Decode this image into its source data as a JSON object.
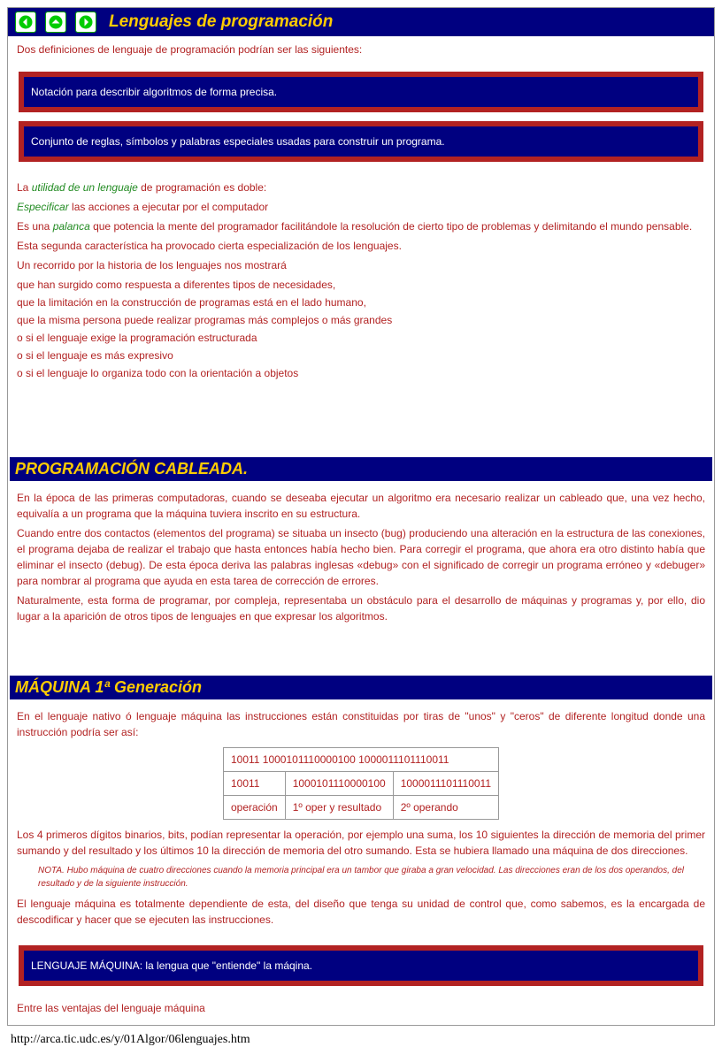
{
  "header": {
    "title": "Lenguajes de programación"
  },
  "intro": "Dos definiciones de lenguaje de programación podrían ser las siguientes:",
  "def1": "Notación para describir algoritmos de forma precisa.",
  "def2": "Conjunto de reglas, símbolos y palabras especiales usadas para construir un programa.",
  "util": {
    "prefix": "La ",
    "em": "utilidad de un lenguaje",
    "suffix": " de programación es doble:"
  },
  "line_especificar": {
    "em": " Especificar",
    "suffix": " las acciones a ejecutar por el computador"
  },
  "line_palanca": {
    "prefix": " Es una ",
    "em": "palanca",
    "suffix": " que potencia la mente del programador facilitándole la resolución de cierto tipo de problemas y delimitando el mundo pensable."
  },
  "line_especializacion": "Esta segunda característica ha provocado cierta especialización de los lenguajes.",
  "line_recorrido": "Un recorrido por la historia de los  lenguajes nos mostrará",
  "bullets": [
    " que han surgido como respuesta a diferentes tipos de necesidades,",
    " que la limitación en la construcción de programas está en el lado humano,",
    " que la misma persona puede realizar programas más complejos o más grandes"
  ],
  "obullets": [
    "o  si el lenguaje exige la programación estructurada",
    "o  si el lenguaje es más expresivo",
    "o  si el lenguaje lo organiza todo con la orientación a objetos"
  ],
  "cableada": {
    "title": "PROGRAMACIÓN CABLEADA.",
    "p1": "En la época de las primeras computadoras, cuando se deseaba ejecutar un algoritmo era necesario realizar un cableado que, una vez hecho, equivalía a un programa que la máquina tuviera inscrito en su estructura.",
    "p2": "Cuando entre dos contactos (elementos del programa) se situaba un insecto (bug) produciendo una alteración en la estructura de las conexiones, el programa dejaba de realizar el trabajo que hasta entonces había hecho bien. Para corregir el programa, que ahora era otro distinto había que eliminar el insecto (debug). De esta época deriva las palabras inglesas «debug» con el significado de corregir un programa erróneo y «debuger» para nombrar al programa que ayuda en esta tarea de corrección de errores.",
    "p3": "Naturalmente, esta forma de programar, por compleja, representaba un obstáculo para el desarrollo de máquinas y programas y, por ello, dio lugar a la aparición de otros tipos de lenguajes en que expresar los algoritmos."
  },
  "maquina": {
    "title": "MÁQUINA 1ª Generación",
    "p1": "En el lenguaje nativo ó lenguaje máquina las instrucciones están constituidas por tiras de \"unos\" y \"ceros\" de diferente longitud donde una instrucción podría ser así:",
    "table": {
      "fullrow": "10011 1000101110000100 1000011101110011",
      "r2": [
        "10011",
        "1000101110000100",
        "1000011101110011"
      ],
      "r3": [
        "operación",
        "1º oper y resultado",
        "2º operando"
      ]
    },
    "p2": "Los 4 primeros dígitos binarios, bits, podían representar la operación, por ejemplo una suma, los 10 siguientes la dirección de memoria del primer sumando y del resultado y los últimos 10 la dirección de memoria del otro sumando. Esta se hubiera llamado una máquina de dos direcciones.",
    "note": "NOTA. Hubo máquina de cuatro direcciones cuando la memoria principal era un tambor que giraba a gran velocidad. Las direcciones eran de los dos operandos, del resultado y de la siguiente instrucción.",
    "p3": "El lenguaje máquina es totalmente dependiente de esta, del diseño que tenga su unidad de control que, como sabemos, es la encargada de descodificar y hacer que se ejecuten las instrucciones.",
    "callout": "LENGUAJE MÁQUINA: la lengua que \"entiende\" la máqina.",
    "p4": "Entre las ventajas del lenguaje máquina"
  },
  "footer_url": "http://arca.tic.udc.es/y/01Algor/06lenguajes.htm"
}
